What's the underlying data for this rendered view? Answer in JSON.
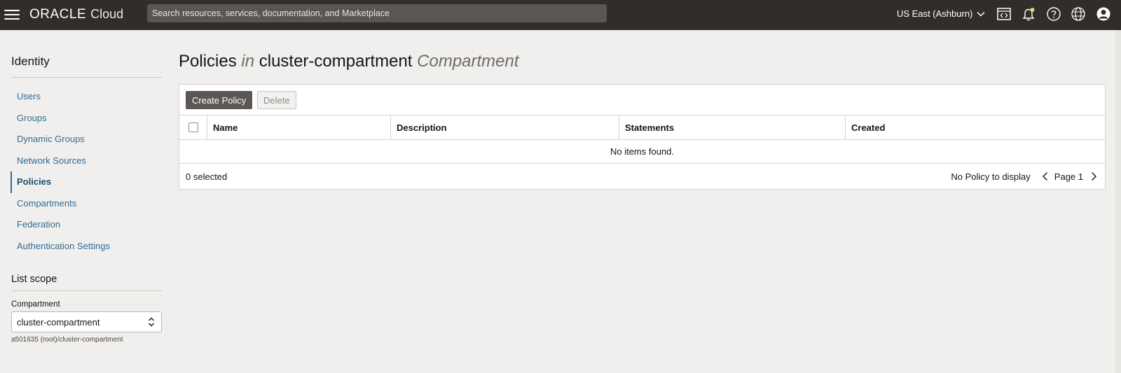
{
  "topbar": {
    "logo_oracle": "ORACLE",
    "logo_cloud": "Cloud",
    "search_placeholder": "Search resources, services, documentation, and Marketplace",
    "region": "US East (Ashburn)",
    "icons": [
      "menu-icon",
      "code-editor-icon",
      "bell-icon",
      "help-icon",
      "globe-icon",
      "user-icon"
    ]
  },
  "sidebar": {
    "title": "Identity",
    "items": [
      {
        "label": "Users",
        "active": false
      },
      {
        "label": "Groups",
        "active": false
      },
      {
        "label": "Dynamic Groups",
        "active": false
      },
      {
        "label": "Network Sources",
        "active": false
      },
      {
        "label": "Policies",
        "active": true
      },
      {
        "label": "Compartments",
        "active": false
      },
      {
        "label": "Federation",
        "active": false
      },
      {
        "label": "Authentication Settings",
        "active": false
      }
    ],
    "scope_title": "List scope",
    "compartment_label": "Compartment",
    "compartment_value": "cluster-compartment",
    "compartment_path": "a501635 (root)/cluster-compartment"
  },
  "main": {
    "title_prefix": "Policies",
    "title_in": "in",
    "title_compartment": "cluster-compartment",
    "title_suffix": "Compartment",
    "create_button": "Create Policy",
    "delete_button": "Delete",
    "columns": [
      "Name",
      "Description",
      "Statements",
      "Created"
    ],
    "empty_text": "No items found.",
    "selected_count": "0 selected",
    "display_text": "No Policy to display",
    "page_label": "Page 1"
  },
  "colors": {
    "topbar_bg": "#312d2a",
    "link": "#2f6c96",
    "primary_button": "#5c5754"
  }
}
